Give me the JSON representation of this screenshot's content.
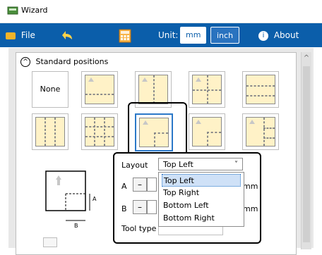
{
  "window": {
    "title": "Wizard"
  },
  "toolbar": {
    "file_label": "File",
    "unit_label": "Unit:",
    "unit_mm": "mm",
    "unit_inch": "inch",
    "about_label": "About",
    "colors": {
      "bar": "#0b5eaa",
      "selected_unit_bg": "#ffffff"
    }
  },
  "standard_positions": {
    "heading": "Standard positions",
    "tiles": [
      {
        "label": "None",
        "icon": "none-text"
      },
      {
        "label": "",
        "icon": "single-page"
      },
      {
        "label": "",
        "icon": "two-columns"
      },
      {
        "label": "",
        "icon": "quadrants"
      },
      {
        "label": "",
        "icon": "two-rows"
      },
      {
        "label": "",
        "icon": "three-columns"
      },
      {
        "label": "",
        "icon": "three-by-three-grid"
      },
      {
        "label": "",
        "icon": "top-left-highlighted"
      },
      {
        "label": "",
        "icon": "top-left"
      },
      {
        "label": "",
        "icon": "right-column"
      }
    ]
  },
  "layout_panel": {
    "layout_label": "Layout",
    "layout_value": "Top Left",
    "options": [
      "Top Left",
      "Top Right",
      "Bottom Left",
      "Bottom Right"
    ],
    "a_label": "A",
    "b_label": "B",
    "minus": "–",
    "unit_text": "mm",
    "tool_type_label": "Tool type"
  },
  "diagram": {
    "a": "A",
    "b": "B"
  }
}
